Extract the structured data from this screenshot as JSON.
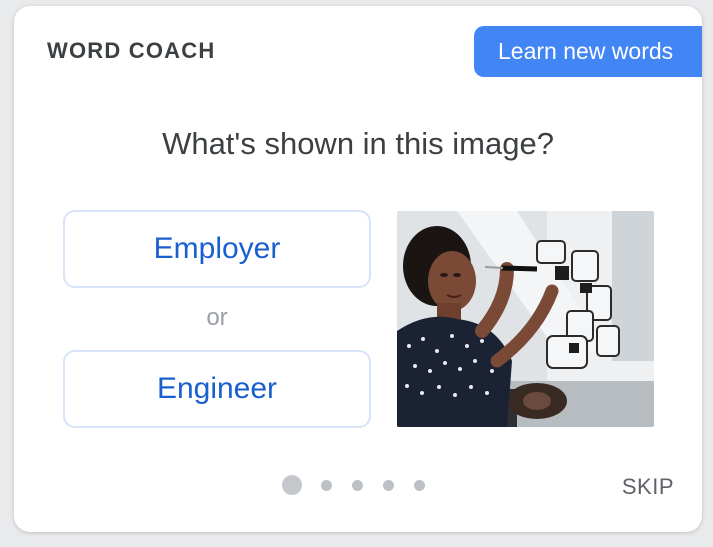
{
  "header": {
    "title": "WORD COACH",
    "learn_button": "Learn new words"
  },
  "quiz": {
    "question": "What's shown in this image?",
    "options": [
      "Employer",
      "Engineer"
    ],
    "separator": "or",
    "image_icon": "woman-building-robot-photo"
  },
  "footer": {
    "progress_total": 5,
    "progress_current": 1,
    "skip_label": "SKIP"
  },
  "colors": {
    "accent": "#4285f4",
    "option_text": "#1a5fd0",
    "option_border": "#d7e3f7"
  }
}
